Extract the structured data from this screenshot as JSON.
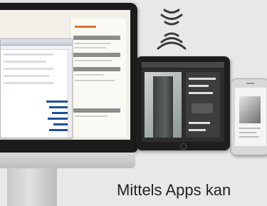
{
  "caption": {
    "text": "Mittels Apps kan"
  },
  "icons": {
    "wireless": "wifi-signal-icon"
  },
  "colors": {
    "accent": "#d8752f",
    "link": "#1f4f9c",
    "background": "#e8e8e8"
  }
}
